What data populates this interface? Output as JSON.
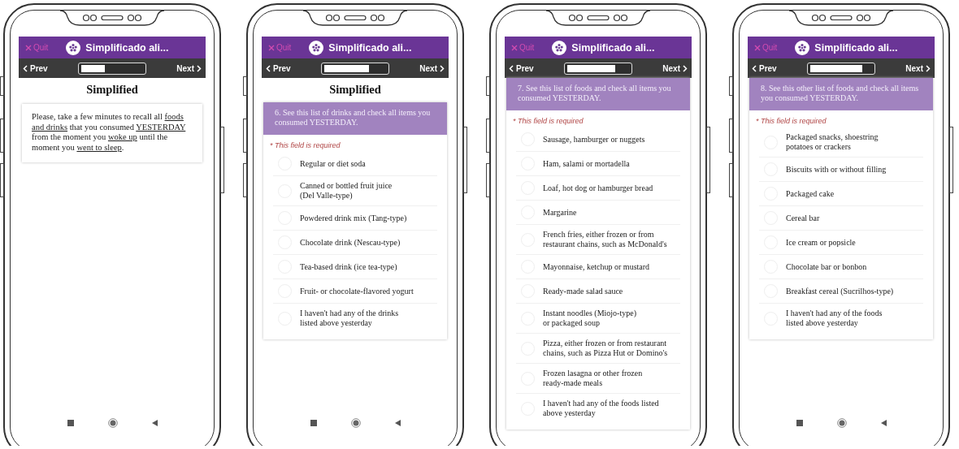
{
  "phones": [
    {
      "header": {
        "quit": "Quit",
        "title": "Simplificado ali..."
      },
      "nav": {
        "prev": "Prev",
        "next": "Next",
        "progress": {
          "level": 0.38
        }
      },
      "heading": "Simplified",
      "intro": [
        {
          "text": "Please, take a few minutes to recall all ",
          "underline": false
        },
        {
          "text": "foods and drinks",
          "underline": true
        },
        {
          "text": " that you consumed ",
          "underline": false
        },
        {
          "text": "YESTERDAY",
          "underline": true
        },
        {
          "text": " from the moment you ",
          "underline": false
        },
        {
          "text": "woke up",
          "underline": true
        },
        {
          "text": " until the moment you ",
          "underline": false
        },
        {
          "text": "went to sleep",
          "underline": true
        },
        {
          "text": ".",
          "underline": false
        }
      ],
      "navigation_bar": true
    },
    {
      "header": {
        "quit": "Quit",
        "title": "Simplificado ali..."
      },
      "nav": {
        "prev": "Prev",
        "next": "Next",
        "progress": {
          "level": 0.72
        }
      },
      "heading": "Simplified",
      "question": {
        "text": "6. See this list of drinks and check all items you consumed YESTERDAY.",
        "required": "* This field is required",
        "options": [
          {
            "label": "Regular or diet soda",
            "checked": false
          },
          {
            "label": "Canned or bottled fruit juice\n(Del Valle-type)",
            "checked": false
          },
          {
            "label": "Powdered drink mix (Tang-type)",
            "checked": false
          },
          {
            "label": "Chocolate drink (Nescau-type)",
            "checked": false
          },
          {
            "label": "Tea-based drink (ice tea-type)",
            "checked": false
          },
          {
            "label": "Fruit- or chocolate-flavored yogurt",
            "checked": false
          },
          {
            "label": "I haven't had any of the drinks\nlisted above yesterday",
            "checked": false
          }
        ]
      },
      "navigation_bar": true
    },
    {
      "header": {
        "quit": "Quit",
        "title": "Simplificado ali..."
      },
      "nav": {
        "prev": "Prev",
        "next": "Next",
        "progress": {
          "level": 0.77
        }
      },
      "question": {
        "text": "7. See this list of foods and check all items you consumed YESTERDAY.",
        "required": "* This field is required",
        "options": [
          {
            "label": "Sausage, hamburger or nuggets",
            "checked": false
          },
          {
            "label": "Ham, salami or mortadella",
            "checked": false
          },
          {
            "label": "Loaf, hot dog or hamburger bread",
            "checked": false
          },
          {
            "label": "Margarine",
            "checked": false
          },
          {
            "label": "French fries, either frozen or from\nrestaurant chains, such as McDonald's",
            "checked": false
          },
          {
            "label": "Mayonnaise, ketchup or mustard",
            "checked": false
          },
          {
            "label": "Ready-made salad sauce",
            "checked": false
          },
          {
            "label": "Instant noodles (Miojo-type)\nor packaged soup",
            "checked": false
          },
          {
            "label": "Pizza, either frozen or from restaurant\nchains, such as Pizza Hut or Domino's",
            "checked": false
          },
          {
            "label": "Frozen lasagna or other frozen\nready-made meals",
            "checked": false
          },
          {
            "label": "I haven't had any of the foods listed\nabove yesterday",
            "checked": false
          }
        ]
      },
      "navigation_bar": false
    },
    {
      "header": {
        "quit": "Quit",
        "title": "Simplificado ali..."
      },
      "nav": {
        "prev": "Prev",
        "next": "Next",
        "progress": {
          "level": 0.84
        }
      },
      "question": {
        "text": "8. See this other list of foods and check all items you consumed YESTERDAY.",
        "required": "* This field is required",
        "options": [
          {
            "label": "Packaged snacks, shoestring\npotatoes or crackers",
            "checked": false
          },
          {
            "label": "Biscuits with or without filling",
            "checked": false
          },
          {
            "label": "Packaged cake",
            "checked": false
          },
          {
            "label": "Cereal bar",
            "checked": false
          },
          {
            "label": "Ice cream or popsicle",
            "checked": false
          },
          {
            "label": "Chocolate bar or bonbon",
            "checked": false
          },
          {
            "label": "Breakfast cereal (Sucrilhos-type)",
            "checked": false
          },
          {
            "label": "I haven't had any of the foods\nlisted above yesterday",
            "checked": false
          }
        ]
      },
      "navigation_bar": true
    }
  ]
}
